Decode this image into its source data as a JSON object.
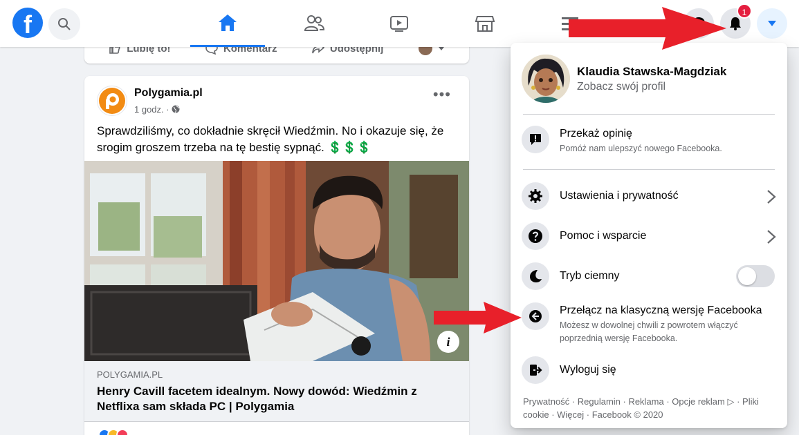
{
  "topbar": {
    "logo_letter": "f",
    "notification_count": "1",
    "nav_tabs": [
      "home",
      "friends",
      "watch",
      "marketplace",
      "menu"
    ]
  },
  "prev_post_actions": {
    "like": "Lubię to!",
    "comment": "Komentarz",
    "share": "Udostępnij"
  },
  "post": {
    "author": "Polygamia.pl",
    "time": "1 godz. · ",
    "text": "Sprawdziliśmy, co dokładnie skręcił Wiedźmin. No i okazuje się, że srogim groszem trzeba na tę bestię sypnąć. 💲💲💲",
    "more": "•••",
    "info": "i",
    "link_domain": "POLYGAMIA.PL",
    "link_title": "Henry Cavill facetem idealnym. Nowy dowód: Wiedźmin z Netflixa sam składa PC | Polygamia"
  },
  "menu": {
    "profile_name": "Klaudia Stawska-Magdziak",
    "profile_sub": "Zobacz swój profil",
    "feedback_label": "Przekaż opinię",
    "feedback_desc": "Pomóż nam ulepszyć nowego Facebooka.",
    "settings_label": "Ustawienia i prywatność",
    "help_label": "Pomoc i wsparcie",
    "dark_label": "Tryb ciemny",
    "dark_mode_on": false,
    "classic_label": "Przełącz na klasyczną wersję Facebooka",
    "classic_desc": "Możesz w dowolnej chwili z powrotem włączyć poprzednią wersję Facebooka.",
    "logout_label": "Wyloguj się",
    "footer": "Prywatność · Regulamin · Reklama · Opcje reklam ▷ · Pliki cookie · Więcej · Facebook © 2020"
  },
  "colors": {
    "brand": "#1877f2",
    "annotation_arrow": "#e8202a",
    "badge": "#e41e3f"
  }
}
